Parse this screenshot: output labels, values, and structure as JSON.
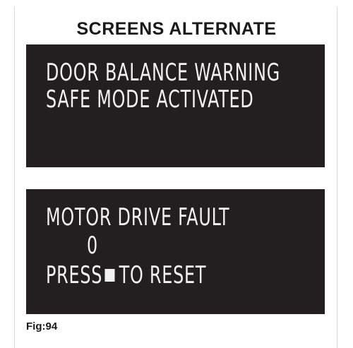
{
  "title": "SCREENS ALTERNATE",
  "screen_1": {
    "line_1": "DOOR BALANCE WARNING",
    "line_2": "SAFE MODE ACTIVATED"
  },
  "screen_2": {
    "line_1": "MOTOR DRIVE FAULT",
    "line_2": "0",
    "line_3_prefix": "PRESS",
    "line_3_icon": "stop-square-icon",
    "line_3_suffix": "TO RESET"
  },
  "figure_label": "Fig:94",
  "colors": {
    "screen_background": "#231f20",
    "screen_text": "#f2f2f2",
    "label_text": "#1a1a1a"
  }
}
